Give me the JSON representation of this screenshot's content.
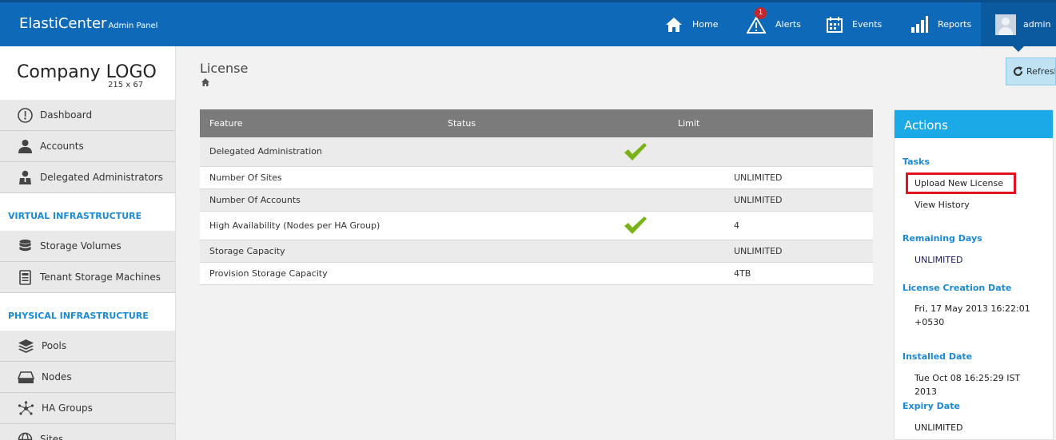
{
  "header": {
    "brand": "ElastiCenter",
    "brand_sub": "Admin Panel",
    "nav": [
      {
        "label": "Home",
        "icon": "home-icon"
      },
      {
        "label": "Alerts",
        "icon": "alert-icon",
        "badge": "1"
      },
      {
        "label": "Events",
        "icon": "calendar-icon"
      },
      {
        "label": "Reports",
        "icon": "bar-chart-icon"
      }
    ],
    "user": "admin"
  },
  "sidebar": {
    "logo": "Company LOGO",
    "logo_size": "215 x 67",
    "items": [
      {
        "label": "Dashboard",
        "icon": "dashboard-icon"
      },
      {
        "label": "Accounts",
        "icon": "user-icon"
      },
      {
        "label": "Delegated Administrators",
        "icon": "admin-icon"
      }
    ],
    "virtual_section": "VIRTUAL INFRASTRUCTURE",
    "virtual_items": [
      {
        "label": "Storage Volumes",
        "icon": "database-icon"
      },
      {
        "label": "Tenant Storage Machines",
        "icon": "machine-icon"
      }
    ],
    "physical_section": "PHYSICAL INFRASTRUCTURE",
    "physical_items": [
      {
        "label": "Pools",
        "icon": "layers-icon"
      },
      {
        "label": "Nodes",
        "icon": "server-icon"
      },
      {
        "label": "HA Groups",
        "icon": "network-icon"
      },
      {
        "label": "Sites",
        "icon": "globe-icon"
      }
    ]
  },
  "main": {
    "title": "License",
    "refresh_label": "Refresh",
    "table": {
      "headers": [
        "Feature",
        "Status",
        "Limit"
      ],
      "rows": [
        {
          "feature": "Delegated Administration",
          "check": true,
          "limit": ""
        },
        {
          "feature": "Number Of Sites",
          "check": false,
          "limit": "UNLIMITED"
        },
        {
          "feature": "Number Of Accounts",
          "check": false,
          "limit": "UNLIMITED"
        },
        {
          "feature": "High Availability (Nodes per HA Group)",
          "check": true,
          "limit": "4"
        },
        {
          "feature": "Storage Capacity",
          "check": false,
          "limit": "UNLIMITED"
        },
        {
          "feature": "Provision Storage Capacity",
          "check": false,
          "limit": "4TB"
        }
      ]
    }
  },
  "actions": {
    "title": "Actions",
    "tasks_label": "Tasks",
    "upload": "Upload New License",
    "history": "View History",
    "remaining_label": "Remaining Days",
    "remaining_value": "UNLIMITED",
    "creation_label": "License Creation Date",
    "creation_value": "Fri, 17 May 2013 16:22:01 +0530",
    "installed_label": "Installed Date",
    "installed_value": "Tue Oct 08 16:25:29 IST 2013",
    "expiry_label": "Expiry Date",
    "expiry_value": "UNLIMITED"
  },
  "colors": {
    "header_bg": "#0e6ab8",
    "accent": "#1ca9e8",
    "check": "#7ab317",
    "highlight": "#e0141e"
  }
}
